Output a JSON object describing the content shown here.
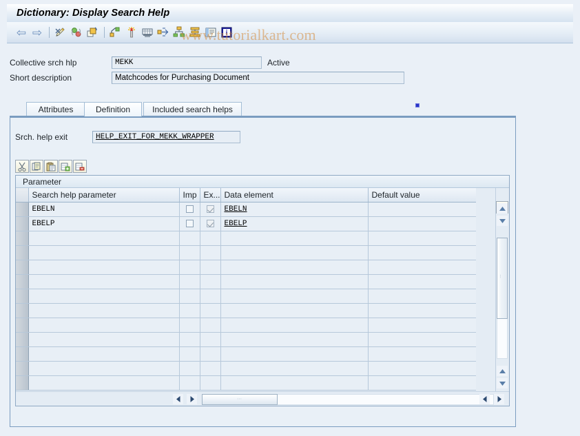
{
  "window": {
    "title": "Dictionary: Display Search Help"
  },
  "toolbar": {
    "items": [
      {
        "name": "back-arrow-icon",
        "label": "⇦"
      },
      {
        "name": "forward-arrow-icon",
        "label": "⇨"
      },
      {
        "name": "display-change-icon",
        "label": ""
      },
      {
        "name": "check-icon",
        "label": ""
      },
      {
        "name": "copy-object-icon",
        "label": ""
      },
      {
        "name": "activate-icon",
        "label": ""
      },
      {
        "name": "where-used-icon",
        "label": ""
      },
      {
        "name": "technical-settings-icon",
        "label": ""
      },
      {
        "name": "navigate-icon",
        "label": ""
      },
      {
        "name": "hierarchy-icon",
        "label": ""
      },
      {
        "name": "stack-icon",
        "label": ""
      },
      {
        "name": "documentation-icon",
        "label": ""
      },
      {
        "name": "info-icon",
        "label": ""
      }
    ],
    "watermark": "www.tutorialkart.com"
  },
  "header_fields": {
    "collective_label": "Collective srch hlp",
    "collective_value": "MEKK",
    "status": "Active",
    "short_desc_label": "Short description",
    "short_desc_value": "Matchcodes for Purchasing Document"
  },
  "tabs": [
    {
      "label": "Attributes",
      "active": false
    },
    {
      "label": "Definition",
      "active": true
    },
    {
      "label": "Included search helps",
      "active": false
    }
  ],
  "definition": {
    "srch_help_exit_label": "Srch. help exit",
    "srch_help_exit_value": "HELP_EXIT_FOR_MEKK_WRAPPER"
  },
  "grid_toolbar": {
    "buttons": [
      {
        "name": "cut-button",
        "icon": "scissors-icon"
      },
      {
        "name": "copy-button",
        "icon": "copy-icon"
      },
      {
        "name": "paste-button",
        "icon": "paste-icon"
      },
      {
        "name": "insert-row-button",
        "icon": "insert-row-icon"
      },
      {
        "name": "delete-row-button",
        "icon": "delete-row-icon"
      }
    ]
  },
  "table": {
    "caption": "Parameter",
    "columns": [
      "Search help parameter",
      "Imp",
      "Ex...",
      "Data element",
      "Default value"
    ],
    "rows": [
      {
        "parameter": "EBELN",
        "imp": false,
        "exp": true,
        "data_element": "EBELN",
        "default_value": ""
      },
      {
        "parameter": "EBELP",
        "imp": false,
        "exp": true,
        "data_element": "EBELP",
        "default_value": ""
      },
      {
        "parameter": "",
        "imp": null,
        "exp": null,
        "data_element": "",
        "default_value": ""
      },
      {
        "parameter": "",
        "imp": null,
        "exp": null,
        "data_element": "",
        "default_value": ""
      },
      {
        "parameter": "",
        "imp": null,
        "exp": null,
        "data_element": "",
        "default_value": ""
      },
      {
        "parameter": "",
        "imp": null,
        "exp": null,
        "data_element": "",
        "default_value": ""
      },
      {
        "parameter": "",
        "imp": null,
        "exp": null,
        "data_element": "",
        "default_value": ""
      },
      {
        "parameter": "",
        "imp": null,
        "exp": null,
        "data_element": "",
        "default_value": ""
      },
      {
        "parameter": "",
        "imp": null,
        "exp": null,
        "data_element": "",
        "default_value": ""
      },
      {
        "parameter": "",
        "imp": null,
        "exp": null,
        "data_element": "",
        "default_value": ""
      },
      {
        "parameter": "",
        "imp": null,
        "exp": null,
        "data_element": "",
        "default_value": ""
      },
      {
        "parameter": "",
        "imp": null,
        "exp": null,
        "data_element": "",
        "default_value": ""
      },
      {
        "parameter": "",
        "imp": null,
        "exp": null,
        "data_element": "",
        "default_value": ""
      }
    ],
    "config_button_name": "table-settings-icon"
  },
  "colors": {
    "background": "#eaf0f7",
    "panel_border": "#7a9cc0",
    "field_bg": "#e7eef5",
    "row_bg": "#e8eff6",
    "watermark": "#d68c3c",
    "marker": "#2a35c8"
  }
}
